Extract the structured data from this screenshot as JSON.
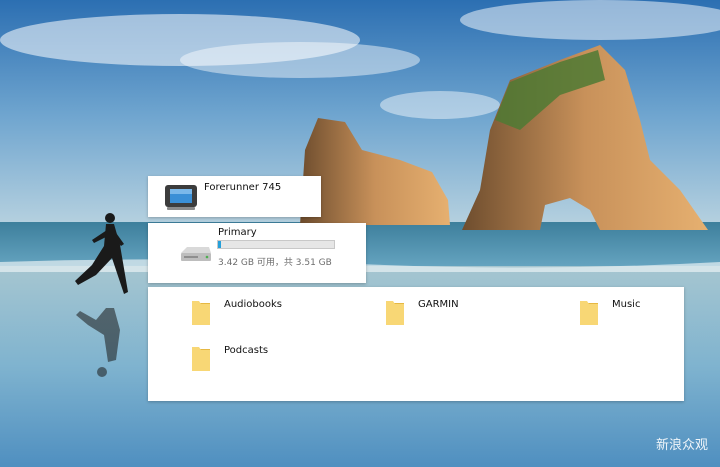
{
  "device": {
    "name": "Forerunner 745",
    "icon": "handheld-device-icon"
  },
  "drive": {
    "name": "Primary",
    "icon": "drive-icon",
    "used_fraction": 0.03,
    "space_text": "3.42 GB 可用，共 3.51 GB",
    "bar_color": "#26a0da"
  },
  "folders": [
    {
      "label": "Audiobooks",
      "icon": "folder-icon"
    },
    {
      "label": "GARMIN",
      "icon": "folder-icon"
    },
    {
      "label": "Music",
      "icon": "folder-icon"
    },
    {
      "label": "Podcasts",
      "icon": "folder-icon"
    }
  ],
  "watermark": {
    "text": "新浪众观"
  },
  "colors": {
    "folder_yellow": "#f8d775",
    "folder_dark": "#e6b843"
  }
}
